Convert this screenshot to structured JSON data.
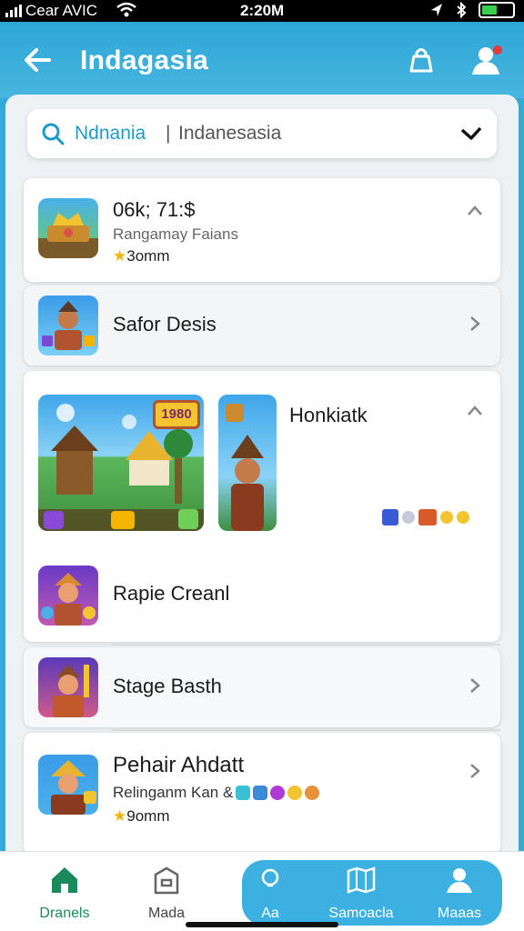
{
  "status_bar": {
    "carrier": "Cear AVIC",
    "time": "2:20M"
  },
  "app_bar": {
    "title": "Indagasia"
  },
  "search": {
    "value": "Ndnania",
    "divider": "|",
    "hint": "Indanesasia"
  },
  "rows": [
    {
      "title": "06k; 71:$",
      "subtitle": "Rangamay Faians",
      "rating": "3omm"
    },
    {
      "title": "Safor Desis"
    },
    {
      "title": "Honkiatk"
    },
    {
      "title": "Rapie Creanl"
    },
    {
      "title": "Stage Basth"
    },
    {
      "title": "Pehair Ahdatt",
      "subtitle": "Relinganm Kan &",
      "rating": "9omm"
    }
  ],
  "banner": {
    "badge": "1980"
  },
  "bottom_nav": [
    {
      "label": "Dranels",
      "icon": "home-icon",
      "color": "#1a8a5a"
    },
    {
      "label": "Mada",
      "icon": "store-icon"
    },
    {
      "label": "Aa",
      "icon": "bulb-icon"
    },
    {
      "label": "Samoacla",
      "icon": "map-icon"
    },
    {
      "label": "Maaas",
      "icon": "person-icon"
    }
  ],
  "colors": {
    "accent": "#34a9d6",
    "star": "#f5b301",
    "nav_active": "#1a8a5a"
  }
}
